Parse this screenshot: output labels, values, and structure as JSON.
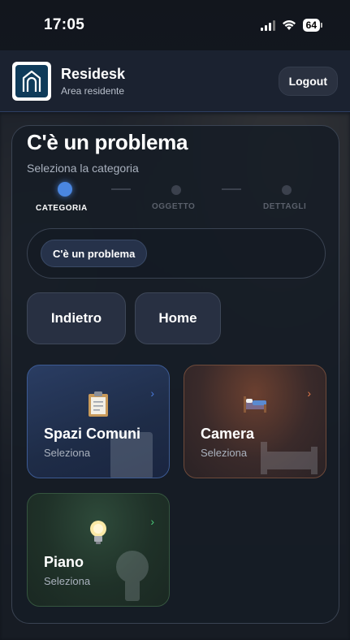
{
  "status_bar": {
    "time": "17:05",
    "battery": "64"
  },
  "header": {
    "brand_name": "Residesk",
    "brand_sub": "Area residente",
    "logout_label": "Logout"
  },
  "page": {
    "title": "C'è un problema",
    "subtitle": "Seleziona la categoria"
  },
  "stepper": {
    "steps": [
      {
        "label": "CATEGORIA",
        "state": "active"
      },
      {
        "label": "OGGETTO",
        "state": "inactive"
      },
      {
        "label": "DETTAGLI",
        "state": "inactive"
      }
    ]
  },
  "breadcrumb": {
    "chip": "C'è un problema"
  },
  "nav": {
    "back_label": "Indietro",
    "home_label": "Home"
  },
  "categories": [
    {
      "title": "Spazi Comuni",
      "subtitle": "Seleziona",
      "icon": "clipboard-icon",
      "accent": "#4a7ad8"
    },
    {
      "title": "Camera",
      "subtitle": "Seleziona",
      "icon": "bed-icon",
      "accent": "#e07a4a"
    },
    {
      "title": "Piano",
      "subtitle": "Seleziona",
      "icon": "lightbulb-icon",
      "accent": "#4ac87a"
    }
  ]
}
